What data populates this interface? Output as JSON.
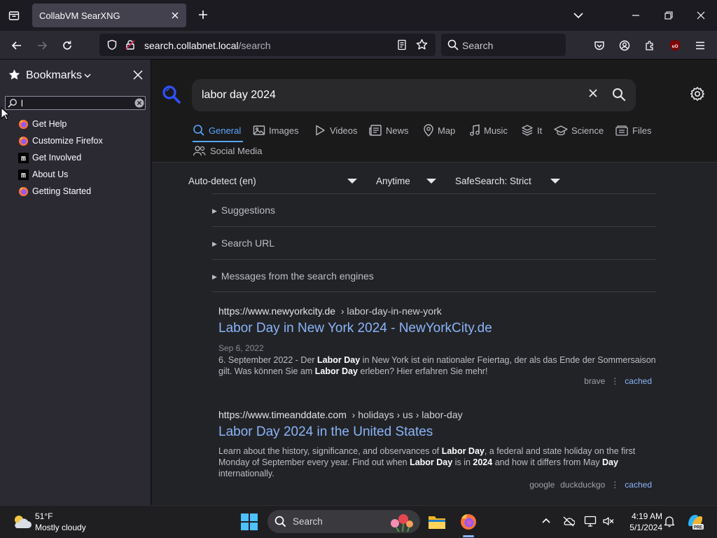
{
  "browser": {
    "tab": {
      "title": "CollabVM SearXNG"
    },
    "url": {
      "host": "search.collabnet.local",
      "path": "/search"
    },
    "search_placeholder": "Search"
  },
  "sidebar": {
    "title": "Bookmarks",
    "filter_value": "l",
    "items": [
      {
        "label": "Get Help",
        "icon": "firefox-icon"
      },
      {
        "label": "Customize Firefox",
        "icon": "firefox-icon"
      },
      {
        "label": "Get Involved",
        "icon": "mozilla-m-icon"
      },
      {
        "label": "About Us",
        "icon": "mozilla-m-icon"
      },
      {
        "label": "Getting Started",
        "icon": "firefox-icon"
      }
    ]
  },
  "search": {
    "query": "labor day 2024",
    "categories": [
      {
        "label": "General",
        "icon": "search-icon",
        "active": true
      },
      {
        "label": "Images",
        "icon": "image-icon"
      },
      {
        "label": "Videos",
        "icon": "play-icon"
      },
      {
        "label": "News",
        "icon": "newspaper-icon"
      },
      {
        "label": "Map",
        "icon": "map-pin-icon"
      },
      {
        "label": "Music",
        "icon": "music-note-icon"
      },
      {
        "label": "It",
        "icon": "layers-icon"
      },
      {
        "label": "Science",
        "icon": "graduation-cap-icon"
      },
      {
        "label": "Files",
        "icon": "files-icon"
      },
      {
        "label": "Social Media",
        "icon": "people-icon"
      }
    ],
    "filters": {
      "language": "Auto-detect (en)",
      "time": "Anytime",
      "safesearch": "SafeSearch: Strict"
    },
    "details": [
      "Suggestions",
      "Search URL",
      "Messages from the search engines"
    ],
    "results": [
      {
        "host": "https://www.newyorkcity.de",
        "path": "› labor-day-in-new-york",
        "title": "Labor Day in New York 2024 - NewYorkCity.de",
        "date": "Sep 6, 2022",
        "snippet_parts": [
          "6. September 2022 - Der ",
          "Labor Day",
          " in New York ist ein nationaler Feiertag, der als das Ende der Sommersaison gilt. Was können Sie am ",
          "Labor Day",
          " erleben? Hier erfahren Sie mehr!"
        ],
        "engines": [
          "brave"
        ],
        "cached": "cached"
      },
      {
        "host": "https://www.timeanddate.com",
        "path": "› holidays › us › labor-day",
        "title": "Labor Day 2024 in the United States",
        "snippet_parts": [
          "Learn about the history, significance, and observances of ",
          "Labor Day",
          ", a federal and state holiday on the first Monday of September every year. Find out when ",
          "Labor Day",
          " is in ",
          "2024",
          " and how it differs from May ",
          "Day",
          " internationally."
        ],
        "engines": [
          "google",
          "duckduckgo"
        ],
        "cached": "cached"
      }
    ]
  },
  "taskbar": {
    "weather_temp": "51°F",
    "weather_desc": "Mostly cloudy",
    "search_placeholder": "Search",
    "time": "4:19 AM",
    "date": "5/1/2024"
  },
  "colors": {
    "accent": "#58a6ff",
    "link": "#8ab4f8",
    "firefox_orange": "#ff7139",
    "firefox_purple": "#9059ff"
  }
}
